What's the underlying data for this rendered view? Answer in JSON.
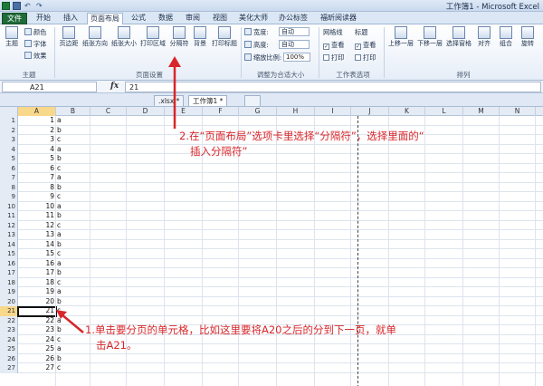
{
  "titlebar": {
    "text": "工作簿1 - Microsoft Excel",
    "undo_icon": "undo-icon",
    "redo_icon": "redo-icon"
  },
  "ribbon_tabs": [
    {
      "label": "文件"
    },
    {
      "label": "开始"
    },
    {
      "label": "插入"
    },
    {
      "label": "页面布局"
    },
    {
      "label": "公式"
    },
    {
      "label": "数据"
    },
    {
      "label": "审阅"
    },
    {
      "label": "视图"
    },
    {
      "label": "美化大师"
    },
    {
      "label": "办公标签"
    },
    {
      "label": "福昕阅读器"
    }
  ],
  "ribbon": {
    "theme": {
      "themes": "主题",
      "colors": "颜色",
      "fonts": "字体",
      "effects": "效果",
      "group": "主题"
    },
    "page_setup": {
      "margins": "页边距",
      "orientation": "纸张方向",
      "size": "纸张大小",
      "print_area": "打印区域",
      "breaks": "分隔符",
      "background": "背景",
      "print_titles": "打印标题",
      "group": "页面设置"
    },
    "scale": {
      "width_label": "宽度:",
      "width_value": "自动",
      "height_label": "高度:",
      "height_value": "自动",
      "scale_label": "缩放比例:",
      "scale_value": "100%",
      "group": "调整为合适大小"
    },
    "sheet_options": {
      "gridlines": "网格线",
      "headings": "标题",
      "view": "查看",
      "print": "打印",
      "group": "工作表选项"
    },
    "arrange": {
      "bring_forward": "上移一层",
      "send_backward": "下移一层",
      "selection_pane": "选择窗格",
      "align": "对齐",
      "group_btn": "组合",
      "rotate": "旋转",
      "group": "排列"
    }
  },
  "formula_bar": {
    "name_box": "A21",
    "fx": "fx",
    "value": "21"
  },
  "doc_tabs": [
    {
      "label": ".xlsx *"
    },
    {
      "label": "工作簿1 *"
    }
  ],
  "grid": {
    "columns": [
      "A",
      "B",
      "C",
      "D",
      "E",
      "F",
      "G",
      "H",
      "I",
      "J",
      "K",
      "L",
      "M",
      "N"
    ],
    "selected_col": "A",
    "selected_row": 21,
    "rows": [
      {
        "n": "1",
        "a": "1",
        "b": "a"
      },
      {
        "n": "2",
        "a": "2",
        "b": "b"
      },
      {
        "n": "3",
        "a": "3",
        "b": "c"
      },
      {
        "n": "4",
        "a": "4",
        "b": "a"
      },
      {
        "n": "5",
        "a": "5",
        "b": "b"
      },
      {
        "n": "6",
        "a": "6",
        "b": "c"
      },
      {
        "n": "7",
        "a": "7",
        "b": "a"
      },
      {
        "n": "8",
        "a": "8",
        "b": "b"
      },
      {
        "n": "9",
        "a": "9",
        "b": "c"
      },
      {
        "n": "10",
        "a": "10",
        "b": "a"
      },
      {
        "n": "11",
        "a": "11",
        "b": "b"
      },
      {
        "n": "12",
        "a": "12",
        "b": "c"
      },
      {
        "n": "13",
        "a": "13",
        "b": "a"
      },
      {
        "n": "14",
        "a": "14",
        "b": "b"
      },
      {
        "n": "15",
        "a": "15",
        "b": "c"
      },
      {
        "n": "16",
        "a": "16",
        "b": "a"
      },
      {
        "n": "17",
        "a": "17",
        "b": "b"
      },
      {
        "n": "18",
        "a": "18",
        "b": "c"
      },
      {
        "n": "19",
        "a": "19",
        "b": "a"
      },
      {
        "n": "20",
        "a": "20",
        "b": "b"
      },
      {
        "n": "21",
        "a": "21",
        "b": "c"
      },
      {
        "n": "22",
        "a": "22",
        "b": "a"
      },
      {
        "n": "23",
        "a": "23",
        "b": "b"
      },
      {
        "n": "24",
        "a": "24",
        "b": "c"
      },
      {
        "n": "25",
        "a": "25",
        "b": "a"
      },
      {
        "n": "26",
        "a": "26",
        "b": "b"
      },
      {
        "n": "27",
        "a": "27",
        "b": "c"
      }
    ]
  },
  "annotations": {
    "step2_line1": "2.在“页面布局”选项卡里选择“分隔符”，选择里面的“",
    "step2_line2": "插入分隔符”",
    "step1_line1": "1.单击要分页的单元格，比如这里要将A20之后的分到下一页，就单",
    "step1_line2": "击A21。",
    "color": "#d8262a"
  }
}
